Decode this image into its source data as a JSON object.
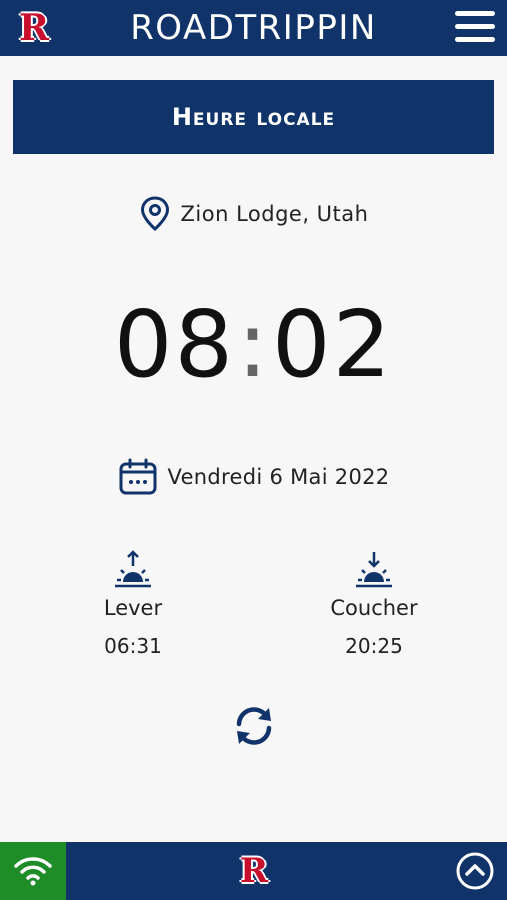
{
  "header": {
    "logo_letter": "R",
    "title": "ROADTRIPPIN",
    "menu_icon": "hamburger-menu-icon"
  },
  "banner": {
    "title": "Heure locale"
  },
  "location": {
    "icon": "map-pin-icon",
    "name": "Zion Lodge, Utah"
  },
  "clock": {
    "hours": "08",
    "separator": ":",
    "minutes": "02"
  },
  "date": {
    "icon": "calendar-icon",
    "text": "Vendredi 6 Mai 2022"
  },
  "sunrise": {
    "icon": "sunrise-icon",
    "label": "Lever",
    "time": "06:31"
  },
  "sunset": {
    "icon": "sunset-icon",
    "label": "Coucher",
    "time": "20:25"
  },
  "refresh": {
    "icon": "refresh-icon"
  },
  "footer": {
    "wifi_icon": "wifi-icon",
    "logo_letter": "R",
    "up_icon": "chevron-up-circle-icon"
  },
  "colors": {
    "brand_navy": "#10336a",
    "logo_red": "#c8102e",
    "wifi_green": "#1e8c27",
    "background": "#f7f7f7"
  }
}
